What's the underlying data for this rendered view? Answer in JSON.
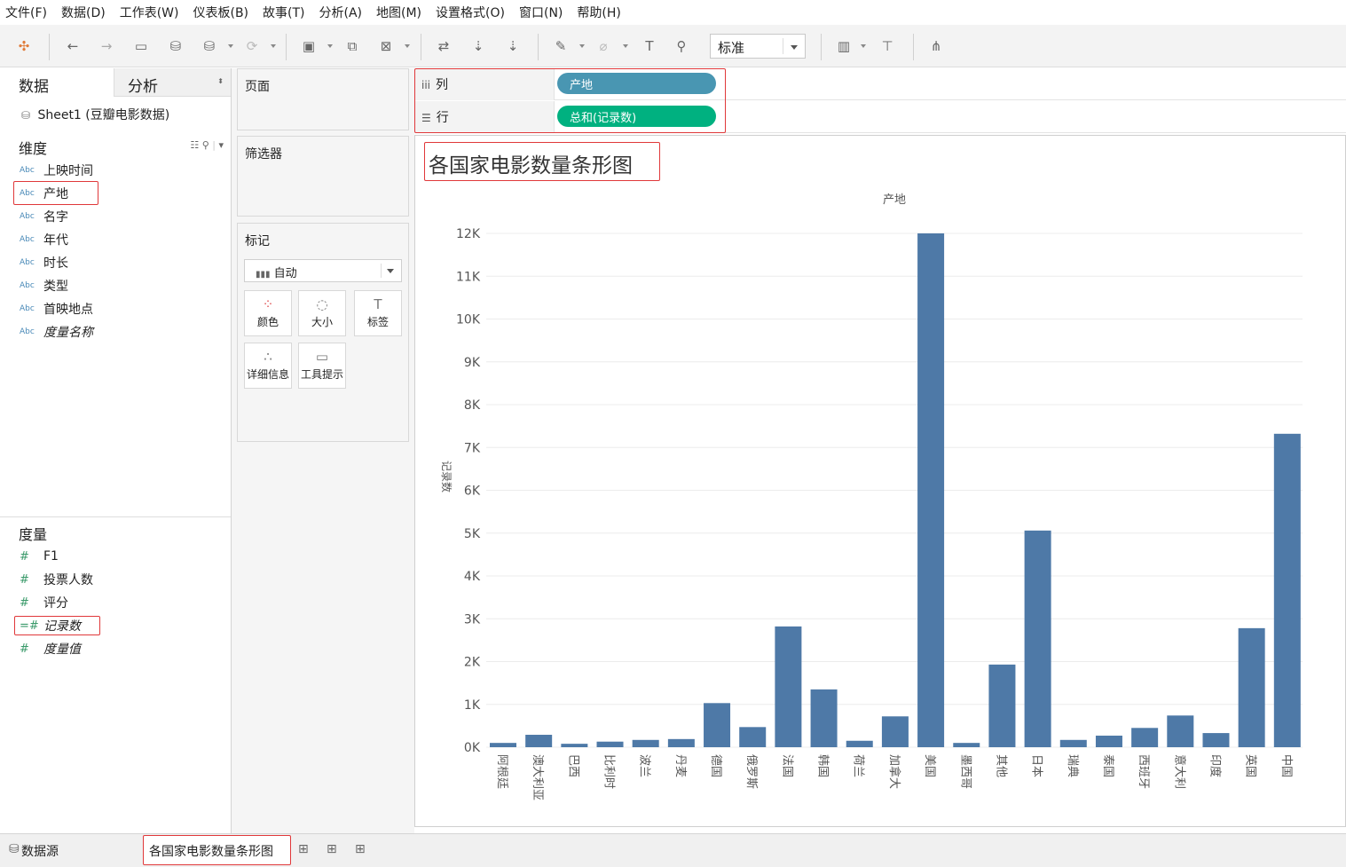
{
  "menu": [
    "文件(F)",
    "数据(D)",
    "工作表(W)",
    "仪表板(B)",
    "故事(T)",
    "分析(A)",
    "地图(M)",
    "设置格式(O)",
    "窗口(N)",
    "帮助(H)"
  ],
  "toolbar": {
    "view_size": "标准",
    "icons": [
      "tableau-logo-icon",
      "undo-icon",
      "redo-icon",
      "save-icon",
      "new-datasource-icon",
      "pause-icon",
      "refresh-icon",
      "new-worksheet-icon",
      "duplicate-icon",
      "clear-icon",
      "swap-icon",
      "sort-ascending-icon",
      "sort-descending-icon",
      "highlight-icon",
      "group-icon",
      "label-icon",
      "pin-icon",
      "show-me-icon",
      "presentation-icon",
      "share-icon"
    ]
  },
  "left": {
    "tab_data": "数据",
    "tab_analysis": "分析",
    "datasource": "Sheet1 (豆瓣电影数据)",
    "dimensions_title": "维度",
    "dimensions": [
      "上映时间",
      "产地",
      "名字",
      "年代",
      "时长",
      "类型",
      "首映地点",
      "度量名称"
    ],
    "dimension_type_label": "Abc",
    "measures_title": "度量",
    "measures": [
      "F1",
      "投票人数",
      "评分",
      "记录数",
      "度量值"
    ]
  },
  "cards": {
    "pages": "页面",
    "filters": "筛选器",
    "marks": "标记",
    "marks_type": "自动",
    "mark_buttons": [
      "颜色",
      "大小",
      "标签",
      "详细信息",
      "工具提示"
    ]
  },
  "shelves": {
    "columns_label": "列",
    "columns_pill": "产地",
    "rows_label": "行",
    "rows_pill": "总和(记录数)"
  },
  "colors": {
    "bar": "#4e79a7",
    "dimension_pill": "#4996b2",
    "measure_pill": "#00b180",
    "highlight_box": "#e0383a"
  },
  "chart_data": {
    "type": "bar",
    "title": "各国家电影数量条形图",
    "xlabel": "产地",
    "ylabel": "记录数",
    "ylim": [
      0,
      12000
    ],
    "yticks": [
      "0K",
      "1K",
      "2K",
      "3K",
      "4K",
      "5K",
      "6K",
      "7K",
      "8K",
      "9K",
      "10K",
      "11K",
      "12K"
    ],
    "grid": true,
    "categories": [
      "阿根廷",
      "澳大利亚",
      "巴西",
      "比利时",
      "波兰",
      "丹麦",
      "德国",
      "俄罗斯",
      "法国",
      "韩国",
      "荷兰",
      "加拿大",
      "美国",
      "墨西哥",
      "其他",
      "日本",
      "瑞典",
      "泰国",
      "西班牙",
      "意大利",
      "印度",
      "英国",
      "中国"
    ],
    "values": [
      100,
      290,
      80,
      130,
      170,
      190,
      1030,
      470,
      2820,
      1350,
      150,
      720,
      12000,
      100,
      1930,
      5060,
      170,
      270,
      450,
      740,
      330,
      2780,
      7320
    ]
  },
  "bottom": {
    "datasource_tab": "数据源",
    "sheet_tab": "各国家电影数量条形图"
  }
}
